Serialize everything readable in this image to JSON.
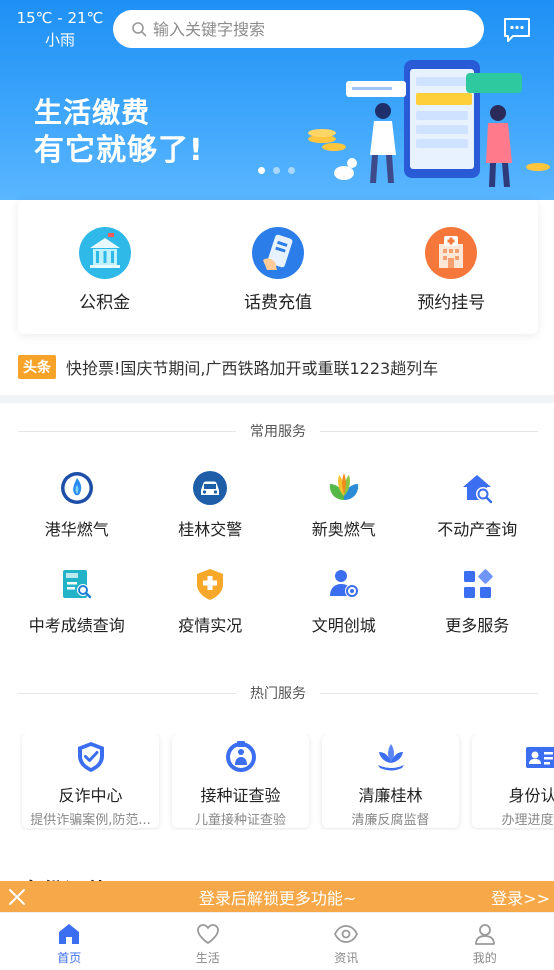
{
  "header": {
    "temperature": "15℃ - 21℃",
    "weather": "小雨",
    "search_placeholder": "输入关键字搜索"
  },
  "banner": {
    "line1": "生活缴费",
    "line2": "有它就够了!",
    "slide_count": 3,
    "active_slide": 1
  },
  "quick_services": [
    {
      "label": "公积金",
      "icon": "building-icon",
      "color": "#2fb9e8"
    },
    {
      "label": "话费充值",
      "icon": "phone-recharge-icon",
      "color": "#2b7de9"
    },
    {
      "label": "预约挂号",
      "icon": "hospital-icon",
      "color": "#f5773a"
    }
  ],
  "headline": {
    "tag": "头条",
    "text": "快抢票!国庆节期间,广西铁路加开或重联1223趟列车"
  },
  "common_services": {
    "title": "常用服务",
    "items": [
      {
        "label": "港华燃气",
        "icon": "gas-flame-icon"
      },
      {
        "label": "桂林交警",
        "icon": "car-icon"
      },
      {
        "label": "新奥燃气",
        "icon": "leaf-logo-icon"
      },
      {
        "label": "不动产查询",
        "icon": "house-search-icon"
      },
      {
        "label": "中考成绩查询",
        "icon": "exam-score-icon"
      },
      {
        "label": "疫情实况",
        "icon": "shield-cross-icon"
      },
      {
        "label": "文明创城",
        "icon": "user-location-icon"
      },
      {
        "label": "更多服务",
        "icon": "grid-more-icon"
      }
    ]
  },
  "hot_services": {
    "title": "热门服务",
    "items": [
      {
        "title": "反诈中心",
        "subtitle": "提供诈骗案例,防范...",
        "icon": "shield-check-icon"
      },
      {
        "title": "接种证查验",
        "subtitle": "儿童接种证查验",
        "icon": "vaccine-badge-icon"
      },
      {
        "title": "清廉桂林",
        "subtitle": "清廉反腐监督",
        "icon": "lotus-icon"
      },
      {
        "title": "身份认证",
        "subtitle": "办理进度查询",
        "icon": "id-card-icon"
      }
    ]
  },
  "next_section_partial": "身份证件",
  "login_bar": {
    "message": "登录后解锁更多功能~",
    "link": "登录>>"
  },
  "tabs": [
    {
      "label": "首页",
      "icon": "home-icon",
      "active": true
    },
    {
      "label": "生活",
      "icon": "heart-icon",
      "active": false
    },
    {
      "label": "资讯",
      "icon": "eye-icon",
      "active": false
    },
    {
      "label": "我的",
      "icon": "user-icon",
      "active": false
    }
  ],
  "colors": {
    "primary": "#1e90f5",
    "accent_orange": "#f7a848",
    "tab_active": "#3b6ef0"
  }
}
